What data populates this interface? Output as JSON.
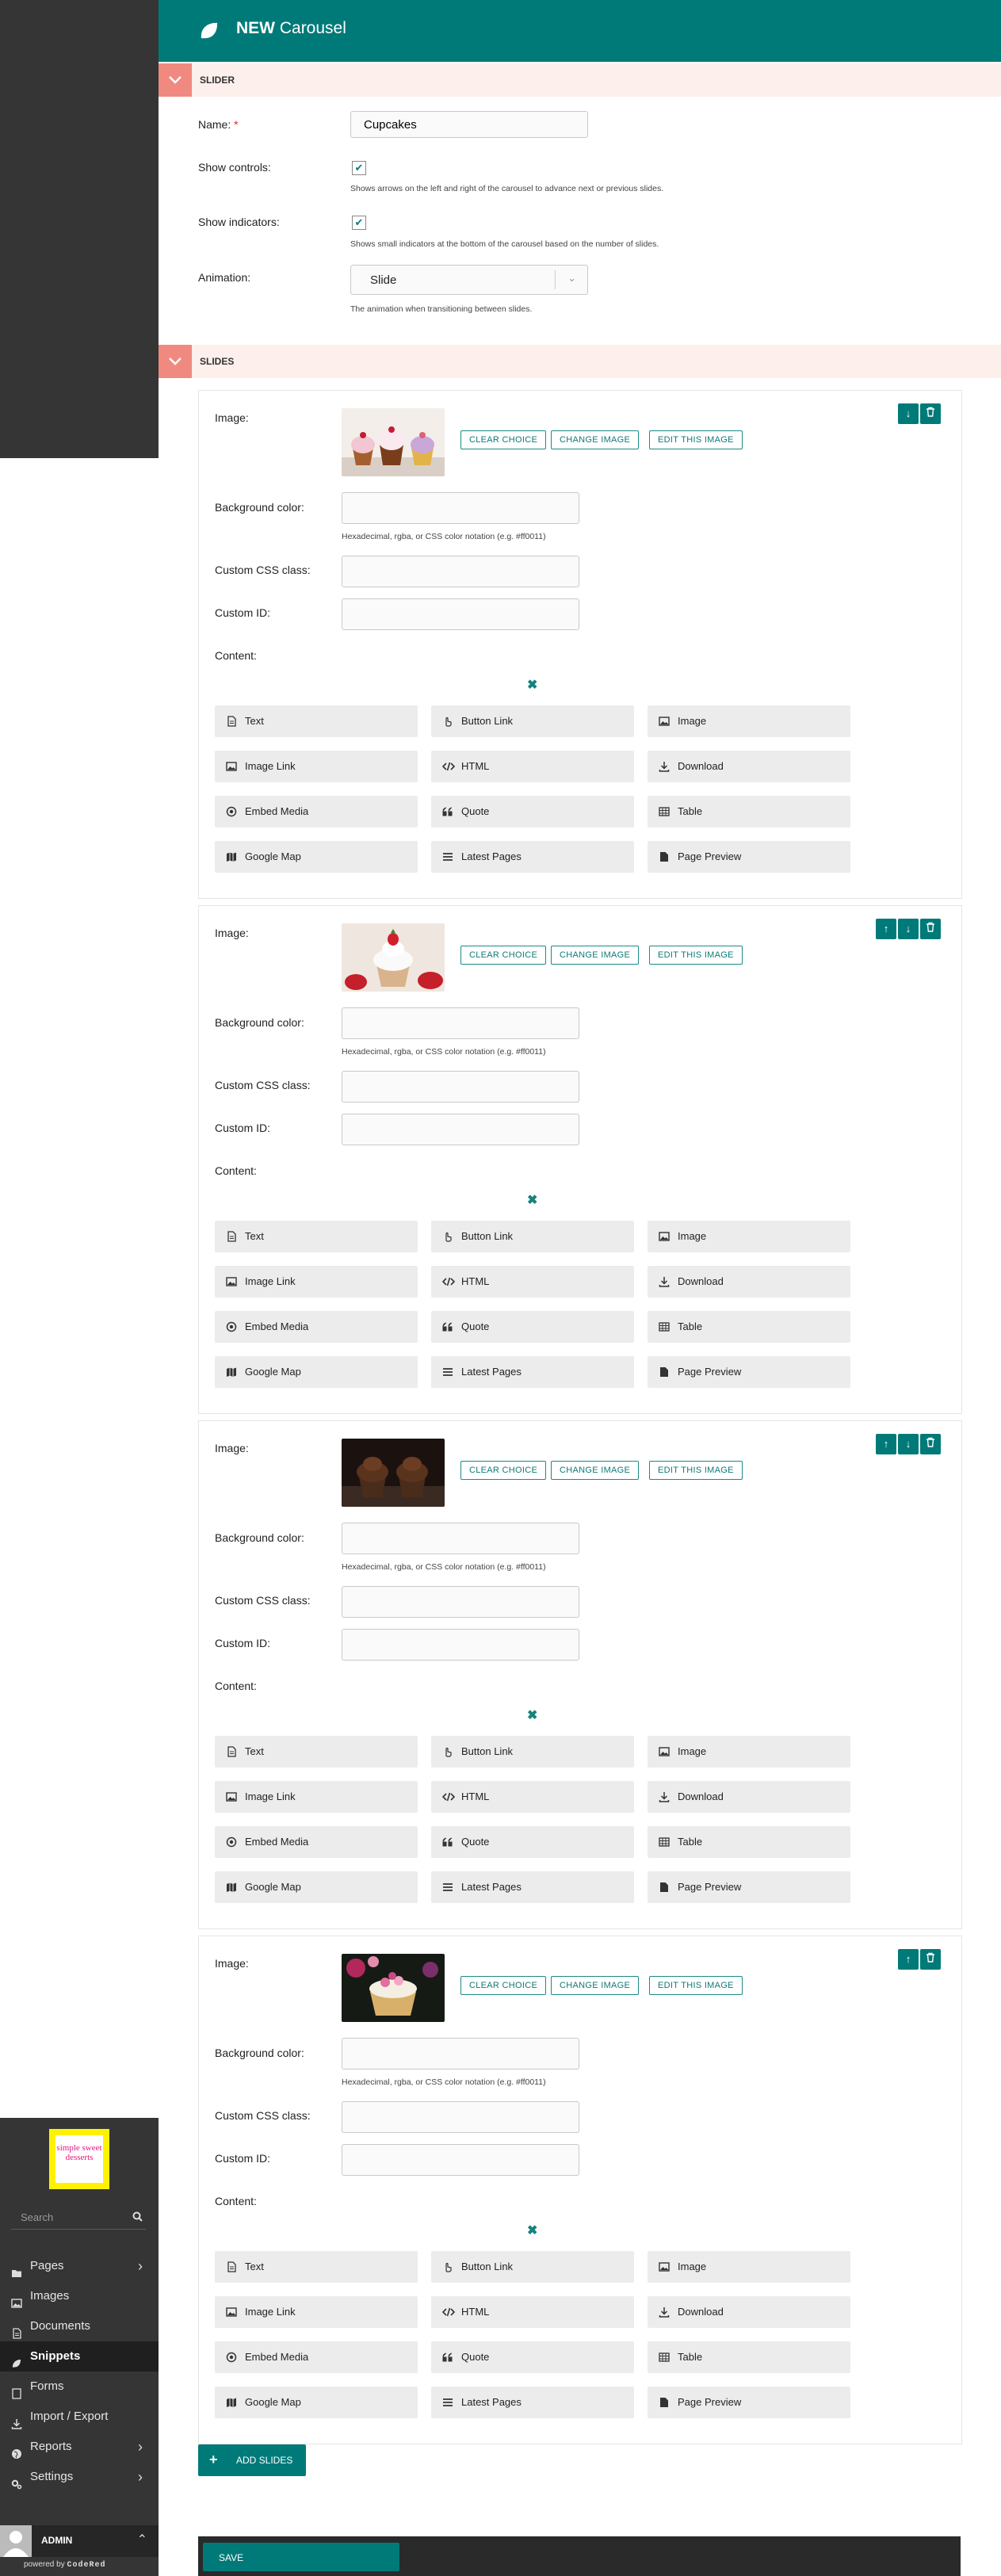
{
  "header": {
    "title_prefix": "NEW",
    "title": "Carousel"
  },
  "sidebar": {
    "logo_text": "simple sweet desserts",
    "search_placeholder": "Search",
    "items": [
      {
        "label": "Pages",
        "icon": "folder-icon",
        "has_submenu": true
      },
      {
        "label": "Images",
        "icon": "image-icon",
        "has_submenu": false
      },
      {
        "label": "Documents",
        "icon": "document-icon",
        "has_submenu": false
      },
      {
        "label": "Snippets",
        "icon": "leaf-icon",
        "has_submenu": false,
        "active": true
      },
      {
        "label": "Forms",
        "icon": "form-icon",
        "has_submenu": false
      },
      {
        "label": "Import / Export",
        "icon": "download-icon",
        "has_submenu": false
      },
      {
        "label": "Reports",
        "icon": "globe-icon",
        "has_submenu": true
      },
      {
        "label": "Settings",
        "icon": "cogs-icon",
        "has_submenu": true
      }
    ],
    "user": "ADMIN",
    "powered_by": "powered by",
    "brand": "CodeRed"
  },
  "slider_section": {
    "title": "SLIDER",
    "name_label": "Name:",
    "required_mark": "*",
    "name_value": "Cupcakes",
    "show_controls_label": "Show controls:",
    "show_controls_checked": true,
    "show_controls_help": "Shows arrows on the left and right of the carousel to advance next or previous slides.",
    "show_indicators_label": "Show indicators:",
    "show_indicators_checked": true,
    "show_indicators_help": "Shows small indicators at the bottom of the carousel based on the number of slides.",
    "animation_label": "Animation:",
    "animation_value": "Slide",
    "animation_help": "The animation when transitioning between slides."
  },
  "slides_section": {
    "title": "SLIDES"
  },
  "slide_labels": {
    "image": "Image:",
    "clear_choice": "CLEAR CHOICE",
    "change_image": "CHANGE IMAGE",
    "edit_image": "EDIT THIS IMAGE",
    "background_color": "Background color:",
    "background_help": "Hexadecimal, rgba, or CSS color notation (e.g. #ff0011)",
    "css_class": "Custom CSS class:",
    "custom_id": "Custom ID:",
    "content": "Content:"
  },
  "blocks": [
    {
      "label": "Text",
      "icon": "document-icon"
    },
    {
      "label": "Button Link",
      "icon": "hand-pointer-icon"
    },
    {
      "label": "Image",
      "icon": "image-icon"
    },
    {
      "label": "Image Link",
      "icon": "image-icon"
    },
    {
      "label": "HTML",
      "icon": "code-icon"
    },
    {
      "label": "Download",
      "icon": "download-icon"
    },
    {
      "label": "Embed Media",
      "icon": "media-icon"
    },
    {
      "label": "Quote",
      "icon": "quote-icon"
    },
    {
      "label": "Table",
      "icon": "table-icon"
    },
    {
      "label": "Google Map",
      "icon": "map-icon"
    },
    {
      "label": "Latest Pages",
      "icon": "list-icon"
    },
    {
      "label": "Page Preview",
      "icon": "doc-full-icon"
    }
  ],
  "slides": [
    {
      "image_subject": "cupcakes-trio",
      "controls": [
        "move-down",
        "delete"
      ]
    },
    {
      "image_subject": "strawberry-cupcake",
      "controls": [
        "move-up",
        "move-down",
        "delete"
      ]
    },
    {
      "image_subject": "chocolate-cupcakes",
      "controls": [
        "move-up",
        "move-down",
        "delete"
      ]
    },
    {
      "image_subject": "flower-cupcakes",
      "controls": [
        "move-up",
        "delete"
      ]
    }
  ],
  "actions": {
    "add_slides": "ADD SLIDES",
    "save": "SAVE"
  },
  "colors": {
    "accent": "#007a78",
    "section_toggle": "#f08a80",
    "section_bar": "#fcefec",
    "sidebar": "#353535"
  }
}
